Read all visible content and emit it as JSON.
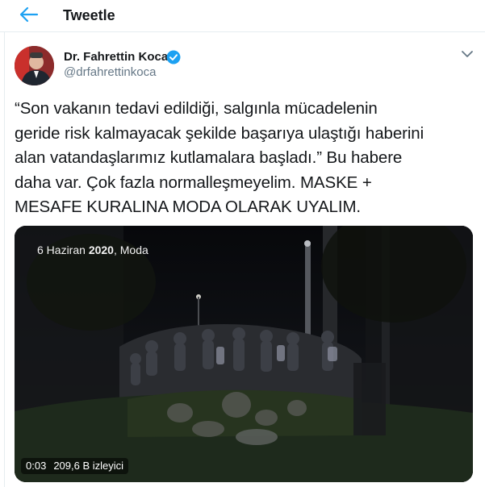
{
  "header": {
    "title": "Tweetle",
    "back_icon": "arrow-left-icon",
    "accent": "#1da1f2"
  },
  "author": {
    "name": "Dr. Fahrettin Koca",
    "handle": "@drfahrettinkoca",
    "verified_icon": "verified-badge-icon",
    "menu_icon": "chevron-down-icon"
  },
  "tweet": {
    "lines": [
      "“Son vakanın tedavi edildiği, salgınla mücadelenin",
      "geride risk kalmayacak şekilde başarıya ulaştığı haberini",
      "alan vatandaşlarımız kutlamalara başladı.” Bu habere",
      "daha var. Çok fazla normalleşmeyelim. MASKE +",
      "MESAFE KURALINA MODA OLARAK UYALIM."
    ]
  },
  "video": {
    "caption_prefix": "6 Haziran ",
    "caption_year": "2020",
    "caption_suffix": ", Moda",
    "elapsed": "0:03",
    "views": "209,6 B izleyici"
  }
}
